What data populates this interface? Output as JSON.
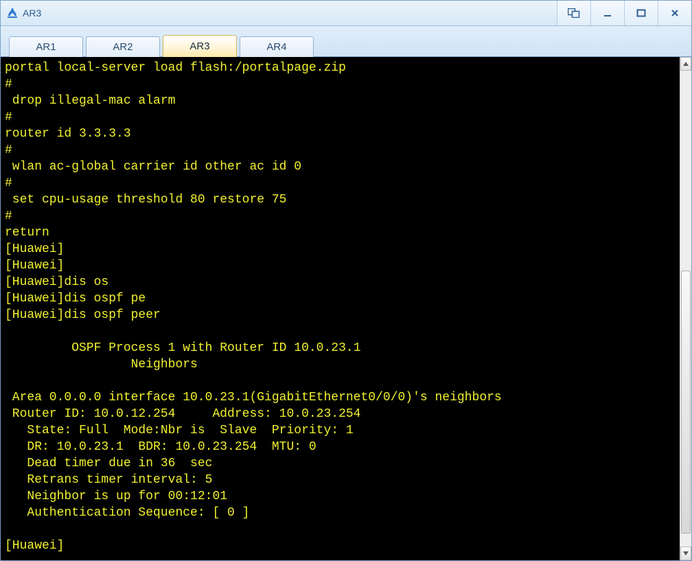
{
  "window": {
    "title": "AR3"
  },
  "tabs": [
    {
      "label": "AR1",
      "active": false
    },
    {
      "label": "AR2",
      "active": false
    },
    {
      "label": "AR3",
      "active": true
    },
    {
      "label": "AR4",
      "active": false
    }
  ],
  "terminal": {
    "lines": [
      "portal local-server load flash:/portalpage.zip",
      "#",
      " drop illegal-mac alarm",
      "#",
      "router id 3.3.3.3",
      "#",
      " wlan ac-global carrier id other ac id 0",
      "#",
      " set cpu-usage threshold 80 restore 75",
      "#",
      "return",
      "[Huawei]",
      "[Huawei]",
      "[Huawei]dis os",
      "[Huawei]dis ospf pe",
      "[Huawei]dis ospf peer",
      "",
      "\t OSPF Process 1 with Router ID 10.0.23.1",
      "\t\t Neighbors ",
      "",
      " Area 0.0.0.0 interface 10.0.23.1(GigabitEthernet0/0/0)'s neighbors",
      " Router ID: 10.0.12.254     Address: 10.0.23.254     ",
      "   State: Full  Mode:Nbr is  Slave  Priority: 1",
      "   DR: 10.0.23.1  BDR: 10.0.23.254  MTU: 0    ",
      "   Dead timer due in 36  sec",
      "   Retrans timer interval: 5 ",
      "   Neighbor is up for 00:12:01     ",
      "   Authentication Sequence: [ 0 ] ",
      "",
      "[Huawei]"
    ]
  }
}
